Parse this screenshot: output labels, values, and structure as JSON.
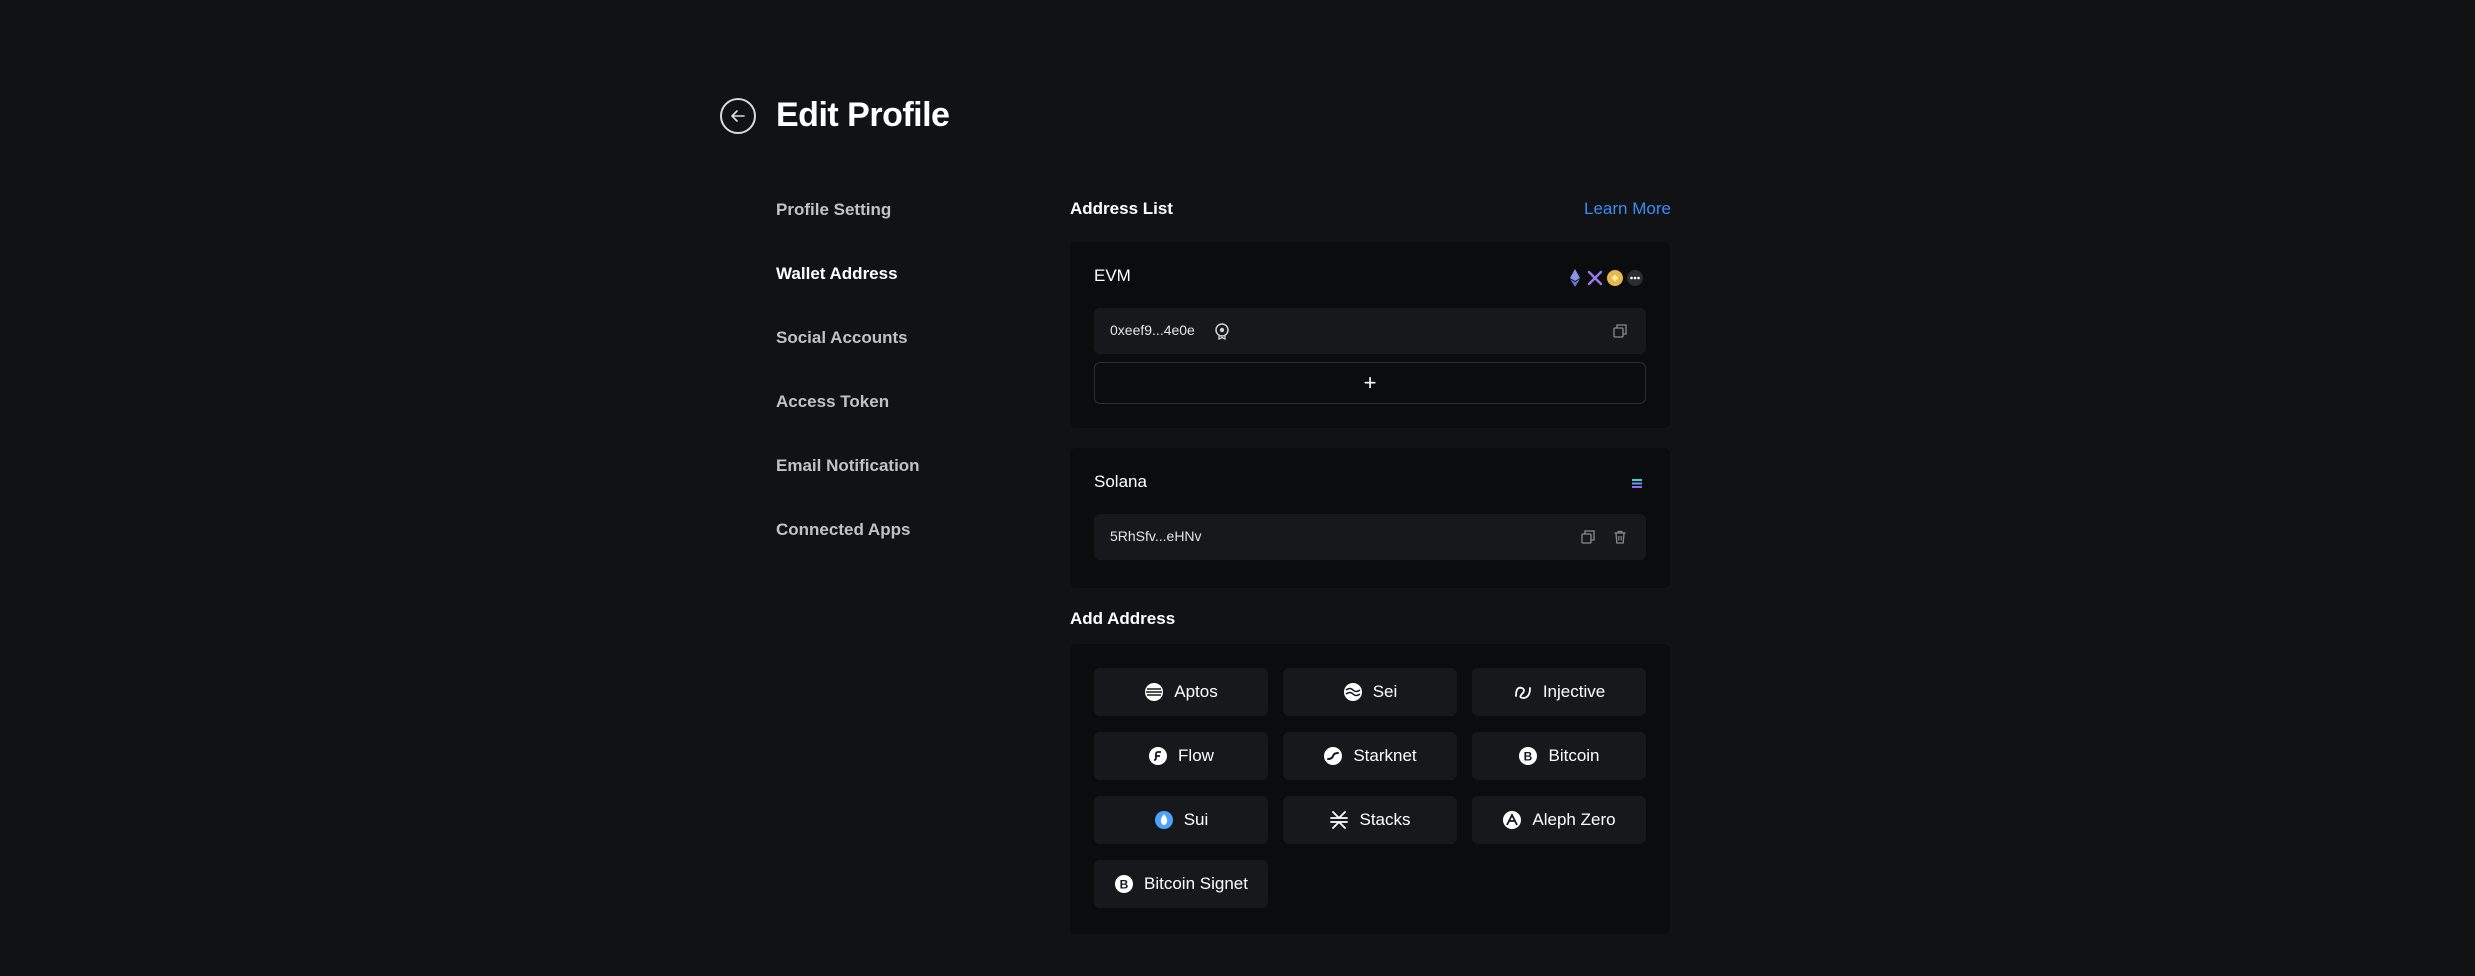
{
  "page": {
    "title": "Edit Profile"
  },
  "nav": {
    "items": [
      {
        "label": "Profile Setting",
        "active": false
      },
      {
        "label": "Wallet Address",
        "active": true
      },
      {
        "label": "Social Accounts",
        "active": false
      },
      {
        "label": "Access Token",
        "active": false
      },
      {
        "label": "Email Notification",
        "active": false
      },
      {
        "label": "Connected Apps",
        "active": false
      }
    ]
  },
  "address_list": {
    "title": "Address List",
    "learn_more": "Learn More",
    "evm": {
      "name": "EVM",
      "icons": [
        "ethereum-icon",
        "arbitrum-icon",
        "bnb-icon",
        "more-icon"
      ],
      "address": "0xeef9...4e0e",
      "add_label": "+"
    },
    "solana": {
      "name": "Solana",
      "icons": [
        "solana-icon"
      ],
      "address": "5RhSfv...eHNv"
    }
  },
  "add_address": {
    "title": "Add Address",
    "chains": [
      {
        "label": "Aptos",
        "icon": "aptos-icon"
      },
      {
        "label": "Sei",
        "icon": "sei-icon"
      },
      {
        "label": "Injective",
        "icon": "injective-icon"
      },
      {
        "label": "Flow",
        "icon": "flow-icon"
      },
      {
        "label": "Starknet",
        "icon": "starknet-icon"
      },
      {
        "label": "Bitcoin",
        "icon": "bitcoin-icon"
      },
      {
        "label": "Sui",
        "icon": "sui-icon"
      },
      {
        "label": "Stacks",
        "icon": "stacks-icon"
      },
      {
        "label": "Aleph Zero",
        "icon": "aleph-zero-icon"
      },
      {
        "label": "Bitcoin Signet",
        "icon": "bitcoin-signet-icon"
      }
    ]
  },
  "colors": {
    "background": "#111214",
    "card": "#0b0c0e",
    "row": "#17181b",
    "accent": "#3b8cf5"
  }
}
